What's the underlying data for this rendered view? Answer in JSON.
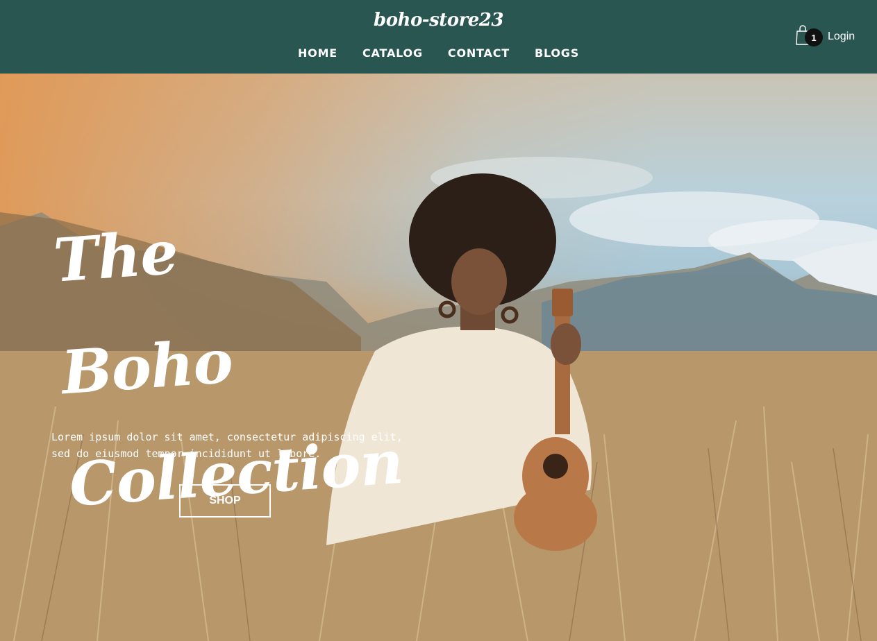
{
  "header": {
    "logo": "boho-store23",
    "nav": [
      "HOME",
      "CATALOG",
      "CONTACT",
      "BLOGS"
    ],
    "cart_count": "1",
    "login_label": "Login"
  },
  "hero": {
    "title_line1": "The Boho",
    "title_line2": "Collection",
    "description": "Lorem ipsum dolor sit amet, consectetur adipiscing elit, sed do eiusmod tempor incididunt ut labore.",
    "shop_label": "SHOP"
  },
  "icons": {
    "cart": "shopping-bag-icon"
  },
  "colors": {
    "header_bg": "#2a5652",
    "overlay": "#e29650",
    "badge_bg": "#111111",
    "text": "#ffffff"
  }
}
